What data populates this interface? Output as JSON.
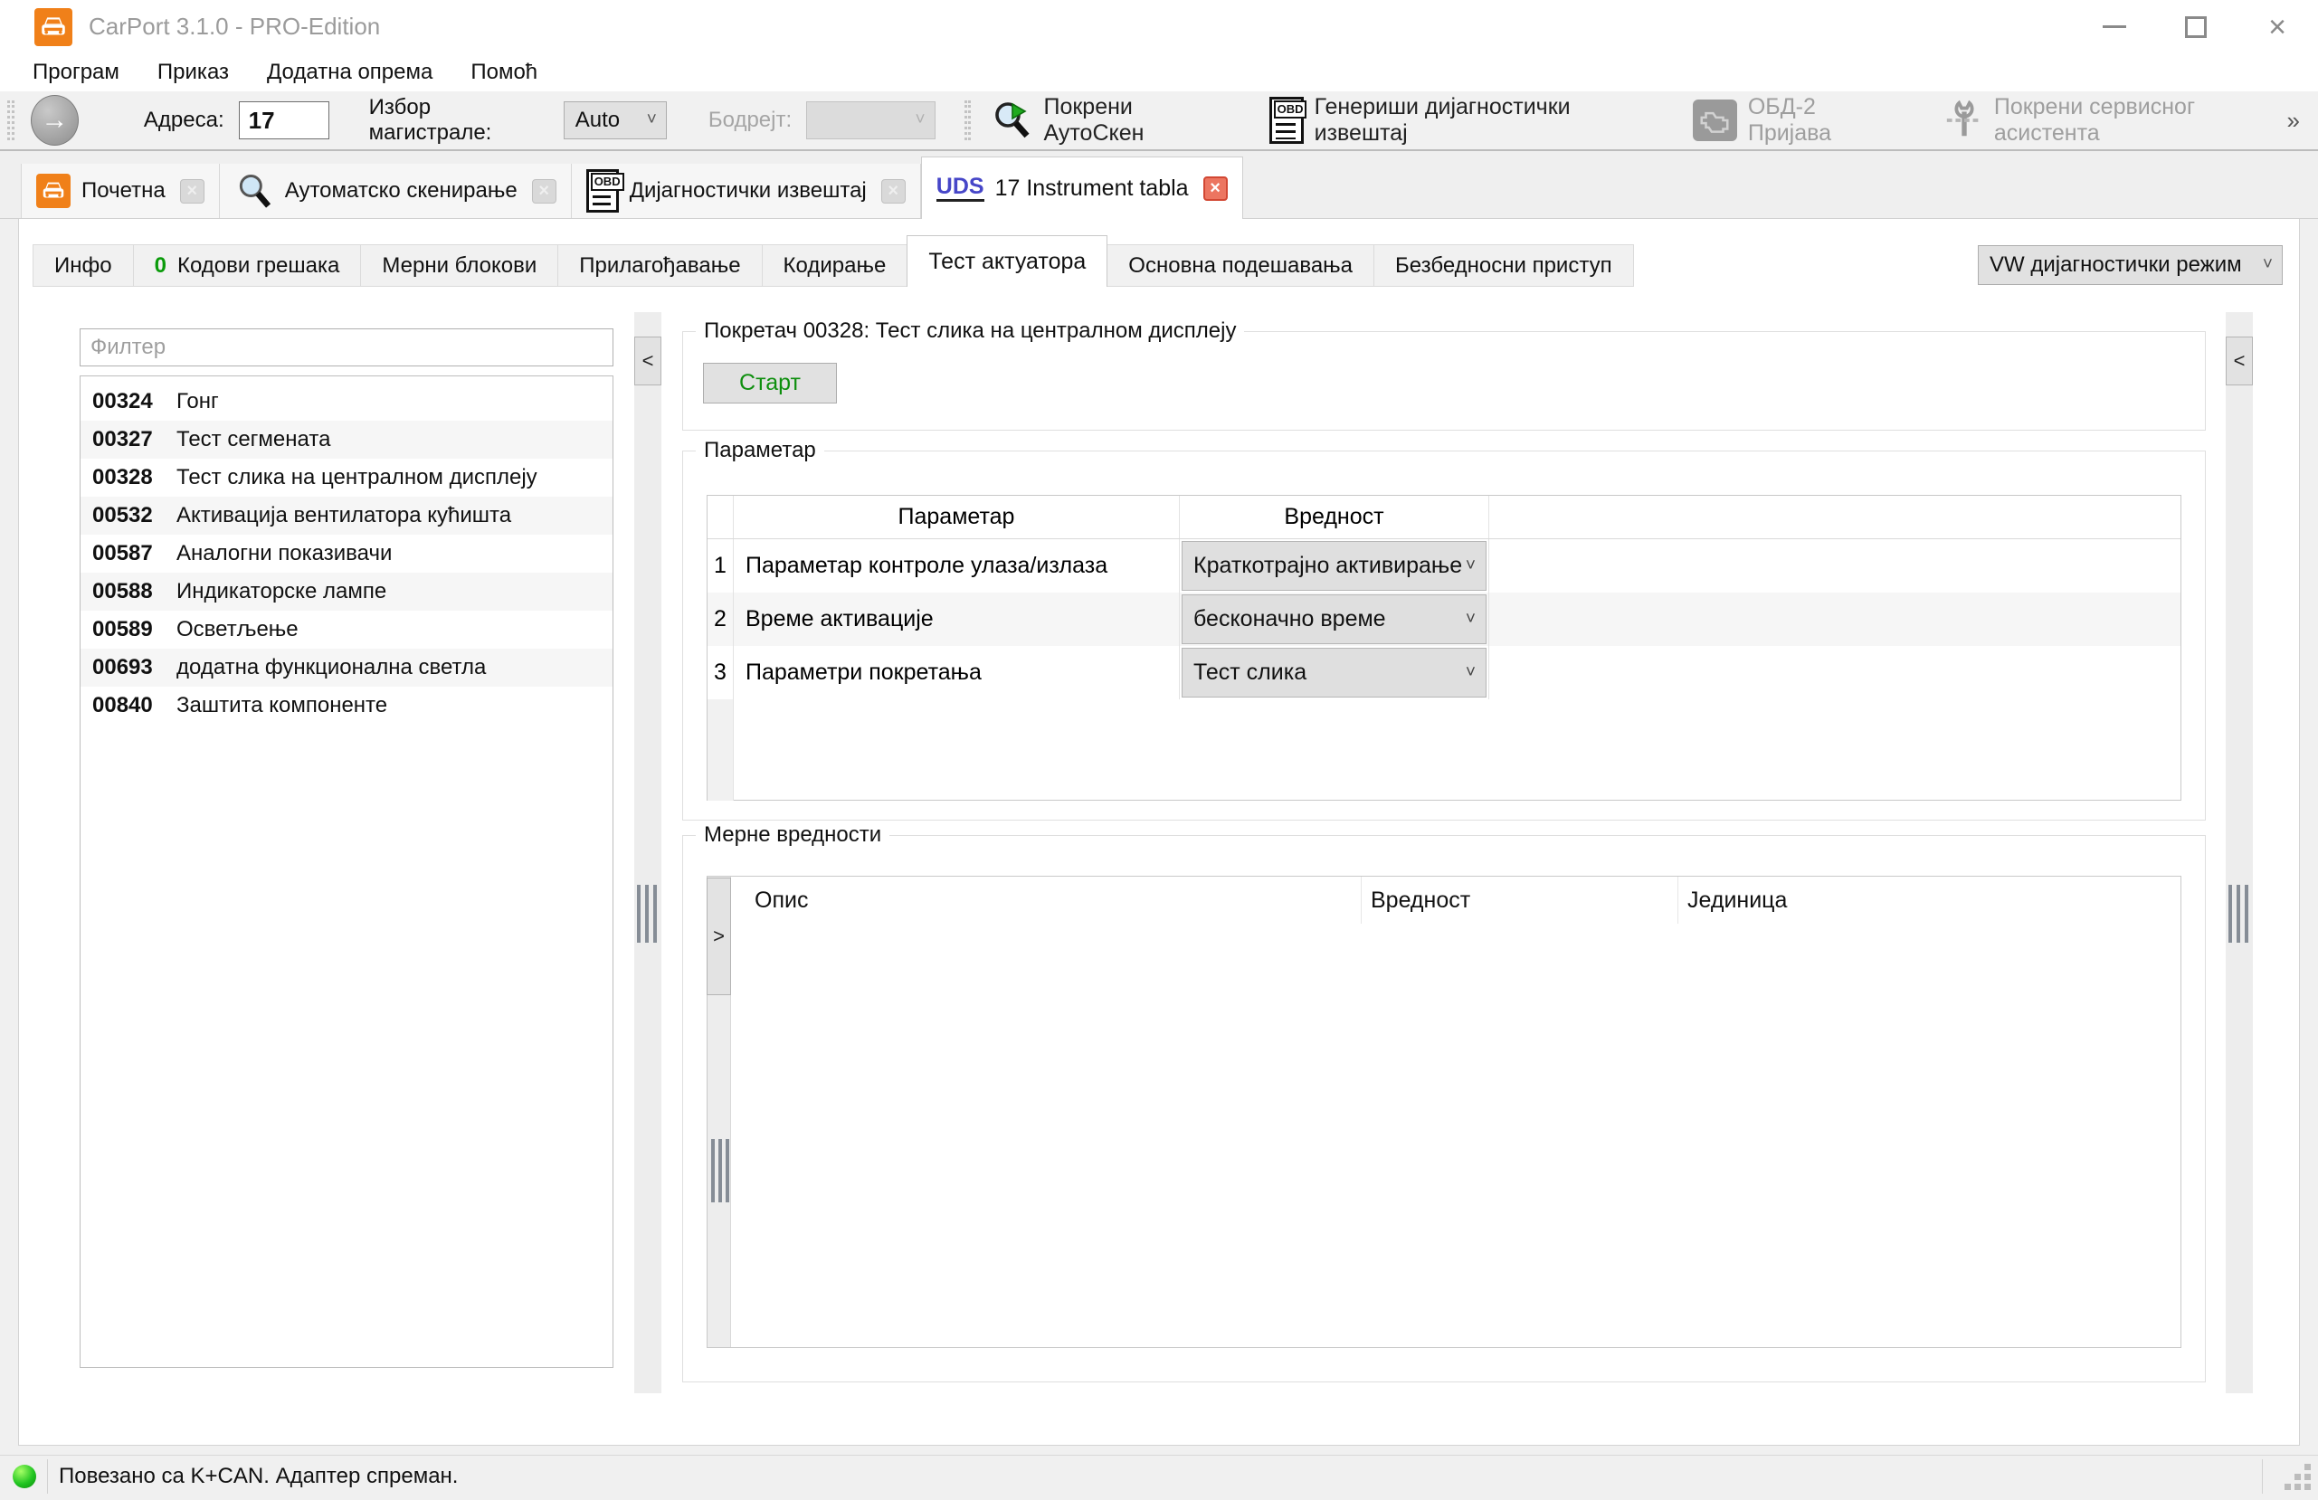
{
  "window": {
    "title": "CarPort 3.1.0 - PRO-Edition"
  },
  "menu": {
    "items": [
      {
        "label": "Програм"
      },
      {
        "label": "Приказ"
      },
      {
        "label": "Додатна опрема"
      },
      {
        "label": "Помоћ"
      }
    ]
  },
  "toolbar": {
    "address_label": "Адреса:",
    "address_value": "17",
    "bus_label": "Избор магистрале:",
    "bus_value": "Auto",
    "baud_label": "Бодрејт:",
    "autoscan_label": "Покрени АутоСкен",
    "report_label": "Генериши дијагностички извештај",
    "obd2_label": "ОБД-2 Пријава",
    "service_label": "Покрени сервисног асистента"
  },
  "doc_tabs": {
    "items": [
      {
        "label": "Почетна"
      },
      {
        "label": "Аутоматско скенирање"
      },
      {
        "label": "Дијагностички извештај"
      },
      {
        "prefix": "UDS",
        "label": "17 Instrument tabla"
      }
    ]
  },
  "sub_tabs": {
    "items": [
      {
        "label": "Инфо"
      },
      {
        "label": "Кодови грешака",
        "badge": "0"
      },
      {
        "label": "Мерни блокови"
      },
      {
        "label": "Прилагођавање"
      },
      {
        "label": "Кодирање"
      },
      {
        "label": "Тест актуатора"
      },
      {
        "label": "Основна подешавања"
      },
      {
        "label": "Безбедносни приступ"
      }
    ],
    "mode": "VW дијагностички режим"
  },
  "left_panel": {
    "filter_placeholder": "Филтер",
    "items": [
      {
        "code": "00324",
        "name": "Гонг"
      },
      {
        "code": "00327",
        "name": "Тест сегмената"
      },
      {
        "code": "00328",
        "name": "Тест слика на централном дисплеју"
      },
      {
        "code": "00532",
        "name": "Активација вентилатора кућишта"
      },
      {
        "code": "00587",
        "name": "Аналогни показивачи"
      },
      {
        "code": "00588",
        "name": "Индикаторске лампе"
      },
      {
        "code": "00589",
        "name": "Осветљење"
      },
      {
        "code": "00693",
        "name": "додатна функционална светла"
      },
      {
        "code": "00840",
        "name": "Заштита компоненте"
      }
    ]
  },
  "actuator": {
    "group_title": "Покретач 00328: Тест слика на централном дисплеју",
    "start_label": "Старт"
  },
  "parameters": {
    "group_title": "Параметар",
    "columns": [
      "Параметар",
      "Вредност"
    ],
    "rows": [
      {
        "num": "1",
        "name": "Параметар контроле улаза/излаза",
        "value": "Краткотрајно активирање"
      },
      {
        "num": "2",
        "name": "Време активације",
        "value": "бесконачно време"
      },
      {
        "num": "3",
        "name": "Параметри покретања",
        "value": "Тест слика"
      }
    ]
  },
  "measurements": {
    "group_title": "Мерне вредности",
    "columns": [
      "Опис",
      "Вредност",
      "Јединица"
    ]
  },
  "status": {
    "text": "Повезано са K+CAN. Адаптер спреман."
  },
  "glyphs": {
    "close": "×",
    "chevron": "˅",
    "collapse": "<",
    "expand": ">",
    "overflow": "»",
    "arrow": "→",
    "obd": "OBD"
  },
  "colors": {
    "brand_orange": "#F08019",
    "ok_green": "#0A9B0A",
    "uds_blue": "#4646C8",
    "active_close": "#EC7560"
  }
}
